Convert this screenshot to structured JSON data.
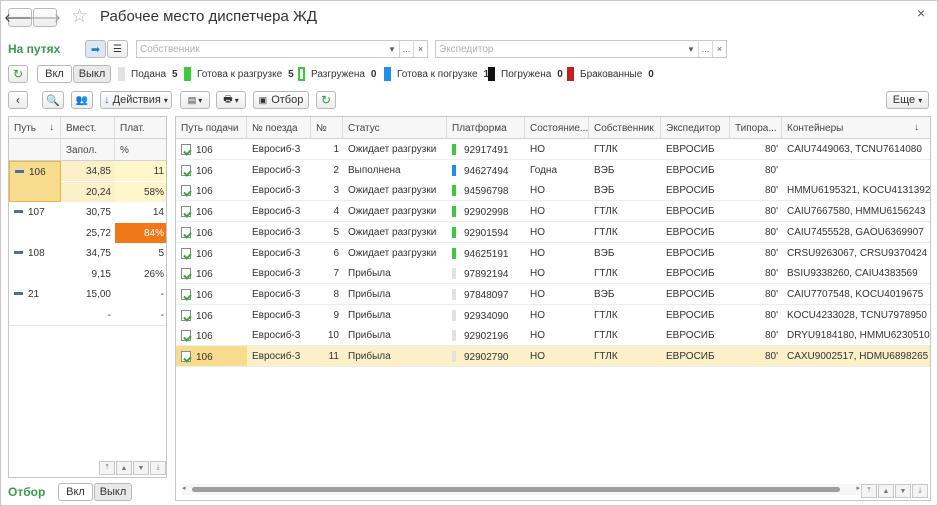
{
  "window": {
    "title": "Рабочее место диспетчера ЖД"
  },
  "filters": {
    "title": "На путях",
    "owner_placeholder": "Собственник",
    "forwarder_placeholder": "Экспедитор",
    "dots": "...",
    "clear": "×",
    "dropdown": "▾"
  },
  "status_bar": {
    "on_label": "Вкл",
    "off_label": "Выкл",
    "legend": [
      {
        "label": "Подана",
        "count": "5",
        "color": "#e2e2e2",
        "style": "fill"
      },
      {
        "label": "Готова к разгрузке",
        "count": "5",
        "color": "#3dc93d",
        "style": "fill"
      },
      {
        "label": "Разгружена",
        "count": "0",
        "color": "#3dc93d",
        "style": "outline"
      },
      {
        "label": "Готова к погрузке",
        "count": "1",
        "color": "#1e90e8",
        "style": "fill"
      },
      {
        "label": "Погружена",
        "count": "0",
        "color": "#111111",
        "style": "fill"
      },
      {
        "label": "Бракованные",
        "count": "0",
        "color": "#c81e1e",
        "style": "fill"
      }
    ]
  },
  "toolbar": {
    "back": "‹",
    "actions_label": "Действия",
    "filter_label": "Отбор",
    "more_label": "Еще"
  },
  "left_table": {
    "headers": {
      "track": "Путь",
      "capacity": "Вмест.",
      "platforms": "Плат.",
      "filled": "Запол.",
      "percent": "%"
    },
    "rows": [
      {
        "track": "106",
        "capacity": "34,85",
        "platforms": "11",
        "filled": "20,24",
        "percent": "58%"
      },
      {
        "track": "107",
        "capacity": "30,75",
        "platforms": "14",
        "filled": "25,72",
        "percent": "84%"
      },
      {
        "track": "108",
        "capacity": "34,75",
        "platforms": "5",
        "filled": "9,15",
        "percent": "26%"
      },
      {
        "track": "21",
        "capacity": "15,00",
        "platforms": "-",
        "filled": "-",
        "percent": "-"
      }
    ]
  },
  "bottom": {
    "filter_title": "Отбор",
    "on_label": "Вкл",
    "off_label": "Выкл"
  },
  "main_table": {
    "headers": [
      "Путь подачи",
      "№ поезда",
      "№",
      "Статус",
      "Платформа",
      "Состояние...",
      "Собственник",
      "Экспедитор",
      "Типора...",
      "Контейнеры"
    ],
    "rows": [
      {
        "track": "106",
        "train": "Евросиб-3",
        "n": "1",
        "status": "Ожидает разгрузки",
        "platform": "92917491",
        "barcolor": "#3dc93d",
        "state": "НО",
        "owner": "ГТЛК",
        "forwarder": "ЕВРОСИБ",
        "type": "80'",
        "containers": "CAIU7449063, TCNU7614080"
      },
      {
        "track": "106",
        "train": "Евросиб-3",
        "n": "2",
        "status": "Выполнена",
        "platform": "94627494",
        "barcolor": "#1e90e8",
        "state": "Годна",
        "owner": "ВЭБ",
        "forwarder": "ЕВРОСИБ",
        "type": "80'",
        "containers": ""
      },
      {
        "track": "106",
        "train": "Евросиб-3",
        "n": "3",
        "status": "Ожидает разгрузки",
        "platform": "94596798",
        "barcolor": "#3dc93d",
        "state": "НО",
        "owner": "ВЭБ",
        "forwarder": "ЕВРОСИБ",
        "type": "80'",
        "containers": "HMMU6195321, KOCU4131392"
      },
      {
        "track": "106",
        "train": "Евросиб-3",
        "n": "4",
        "status": "Ожидает разгрузки",
        "platform": "92902998",
        "barcolor": "#3dc93d",
        "state": "НО",
        "owner": "ГТЛК",
        "forwarder": "ЕВРОСИБ",
        "type": "80'",
        "containers": "CAIU7667580, HMMU6156243"
      },
      {
        "track": "106",
        "train": "Евросиб-3",
        "n": "5",
        "status": "Ожидает разгрузки",
        "platform": "92901594",
        "barcolor": "#3dc93d",
        "state": "НО",
        "owner": "ГТЛК",
        "forwarder": "ЕВРОСИБ",
        "type": "80'",
        "containers": "CAIU7455528, GAOU6369907"
      },
      {
        "track": "106",
        "train": "Евросиб-3",
        "n": "6",
        "status": "Ожидает разгрузки",
        "platform": "94625191",
        "barcolor": "#3dc93d",
        "state": "НО",
        "owner": "ВЭБ",
        "forwarder": "ЕВРОСИБ",
        "type": "80'",
        "containers": "CRSU9263067, CRSU9370424"
      },
      {
        "track": "106",
        "train": "Евросиб-3",
        "n": "7",
        "status": "Прибыла",
        "platform": "97892194",
        "barcolor": "#e2e2e2",
        "state": "НО",
        "owner": "ГТЛК",
        "forwarder": "ЕВРОСИБ",
        "type": "80'",
        "containers": "BSIU9338260, CAIU4383569"
      },
      {
        "track": "106",
        "train": "Евросиб-3",
        "n": "8",
        "status": "Прибыла",
        "platform": "97848097",
        "barcolor": "#e2e2e2",
        "state": "НО",
        "owner": "ВЭБ",
        "forwarder": "ЕВРОСИБ",
        "type": "80'",
        "containers": "CAIU7707548, KOCU4019675"
      },
      {
        "track": "106",
        "train": "Евросиб-3",
        "n": "9",
        "status": "Прибыла",
        "platform": "92934090",
        "barcolor": "#e2e2e2",
        "state": "НО",
        "owner": "ГТЛК",
        "forwarder": "ЕВРОСИБ",
        "type": "80'",
        "containers": "KOCU4233028, TCNU7978950"
      },
      {
        "track": "106",
        "train": "Евросиб-3",
        "n": "10",
        "status": "Прибыла",
        "platform": "92902196",
        "barcolor": "#e2e2e2",
        "state": "НО",
        "owner": "ГТЛК",
        "forwarder": "ЕВРОСИБ",
        "type": "80'",
        "containers": "DRYU9184180, HMMU6230510"
      },
      {
        "track": "106",
        "train": "Евросиб-3",
        "n": "11",
        "status": "Прибыла",
        "platform": "92902790",
        "barcolor": "#e2e2e2",
        "state": "НО",
        "owner": "ГТЛК",
        "forwarder": "ЕВРОСИБ",
        "type": "80'",
        "containers": "CAXU9002517, HDMU6898265"
      }
    ]
  },
  "colors": {
    "accent_green": "#3a9a4a",
    "selected_row": "#fbf0c8",
    "selected_cell": "#f6dc8c",
    "warn_orange": "#f07818",
    "light_yellow": "#fff6cc"
  }
}
